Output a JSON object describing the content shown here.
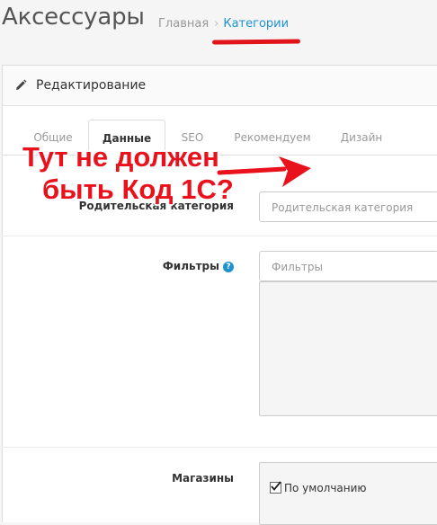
{
  "page": {
    "title": "Аксессуары"
  },
  "breadcrumb": {
    "home": "Главная",
    "separator": "›",
    "current": "Категории"
  },
  "panel": {
    "heading": "Редактирование",
    "heading_icon": "pencil-icon"
  },
  "tabs": [
    {
      "label": "Общие",
      "active": false
    },
    {
      "label": "Данные",
      "active": true
    },
    {
      "label": "SEO",
      "active": false
    },
    {
      "label": "Рекомендуем",
      "active": false
    },
    {
      "label": "Дизайн",
      "active": false
    }
  ],
  "annotation": {
    "line1": "Тут не должен",
    "line2": "быть Код 1С?",
    "color": "#e8111c"
  },
  "form": {
    "parent_category": {
      "label": "Родительская категория",
      "placeholder": "Родительская категория"
    },
    "filters": {
      "label": "Фильтры",
      "placeholder": "Фильтры",
      "help_icon": "?"
    },
    "stores": {
      "label": "Магазины",
      "default_option": "По умолчанию",
      "default_checked": true
    }
  },
  "colors": {
    "accent": "#1e91cf",
    "annotation_red": "#e8111c"
  }
}
